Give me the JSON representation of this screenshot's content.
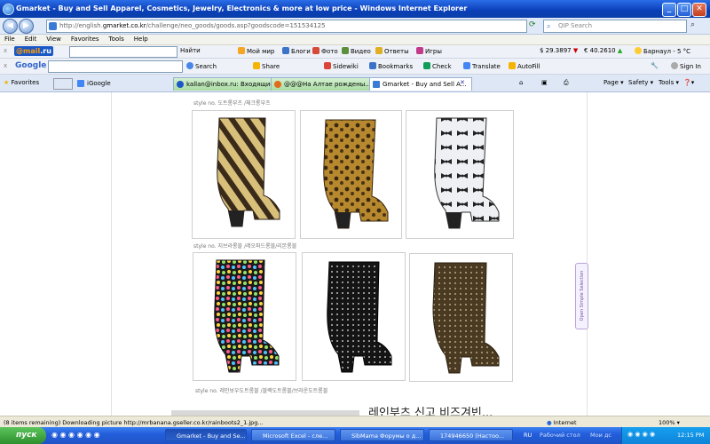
{
  "window": {
    "title": "Gmarket - Buy and Sell Apparel, Cosmetics, Jewelry, Electronics & more at low price - Windows Internet Explorer",
    "controls": {
      "minimize": "_",
      "maximize": "□",
      "close": "✕"
    }
  },
  "address": {
    "url_pre": "http://english.",
    "url_domain": "gmarket.co.kr",
    "url_post": "/challenge/neo_goods/goods.asp?goodscode=151534125",
    "search_placeholder": "QIP Search"
  },
  "menu": [
    "File",
    "Edit",
    "View",
    "Favorites",
    "Tools",
    "Help"
  ],
  "mailbar": {
    "logo_main": "@mail",
    "logo_suffix": ".ru",
    "search_button": "Найти",
    "items": [
      "Мой мир",
      "Блоги",
      "Фото",
      "Видео",
      "Ответы",
      "Игры"
    ],
    "usd": "$ 29.3897",
    "eur": "€ 40.2610",
    "weather": "Барнаул - 5 °C"
  },
  "googlebar": {
    "logo": "Google",
    "items": [
      "Search",
      "Share",
      "Sidewiki",
      "Bookmarks",
      "Check",
      "Translate",
      "AutoFill"
    ],
    "sign_in": "Sign In"
  },
  "tabs": {
    "favorites": "Favorites",
    "igoogle": "iGoogle",
    "items": [
      {
        "label": "kallan@inbox.ru: Входящие"
      },
      {
        "label": "@@@На Алтае рождены......"
      },
      {
        "label": "Gmarket - Buy and Sell A..."
      }
    ],
    "right_items": [
      "Page",
      "Safety",
      "Tools"
    ]
  },
  "content": {
    "caption1": "style no. 도트롱부츠 /체크롱부츠",
    "caption2": "style no. 지브라롱블 /레오파드롱블/리본롱블",
    "caption3": "style no. 레인보우도트롱블 /블랙도트롱블/브라운도트롱블",
    "side_widget": "Open Simple Selection",
    "korean_banner": "레인부츠 신고 비즈겨빈..."
  },
  "status": {
    "text": "(8 items remaining) Downloading picture http://mrbanana.gseller.co.kr/rainboots2_1.jpg...",
    "zone": "Internet",
    "zoom": "100%"
  },
  "taskbar": {
    "start": "пуск",
    "buttons": [
      "Gmarket - Buy and Se...",
      "Microsoft Excel - сле...",
      "SibMama Форумы о д...",
      "174946650 (Настоо..."
    ],
    "lang": "RU",
    "desktop": "Рабочий стол",
    "my_docs": "Мои дс",
    "time": "12:15 PM"
  },
  "colors": {
    "titlebar": "#0a3fb8",
    "taskbar": "#245edb",
    "start": "#2d8f2d"
  }
}
